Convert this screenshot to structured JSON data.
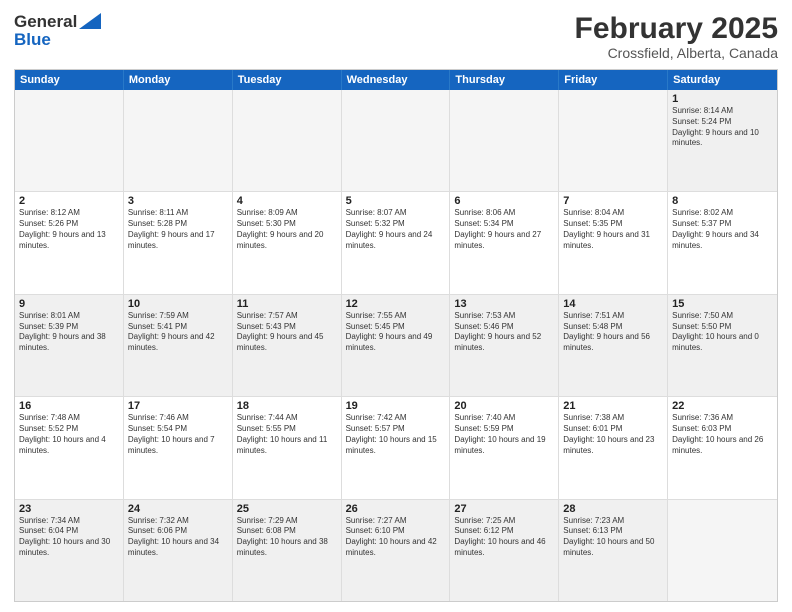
{
  "header": {
    "logo_general": "General",
    "logo_blue": "Blue",
    "month_title": "February 2025",
    "location": "Crossfield, Alberta, Canada"
  },
  "weekdays": [
    "Sunday",
    "Monday",
    "Tuesday",
    "Wednesday",
    "Thursday",
    "Friday",
    "Saturday"
  ],
  "rows": [
    [
      {
        "day": "",
        "text": "",
        "empty": true
      },
      {
        "day": "",
        "text": "",
        "empty": true
      },
      {
        "day": "",
        "text": "",
        "empty": true
      },
      {
        "day": "",
        "text": "",
        "empty": true
      },
      {
        "day": "",
        "text": "",
        "empty": true
      },
      {
        "day": "",
        "text": "",
        "empty": true
      },
      {
        "day": "1",
        "text": "Sunrise: 8:14 AM\nSunset: 5:24 PM\nDaylight: 9 hours and 10 minutes.",
        "empty": false
      }
    ],
    [
      {
        "day": "2",
        "text": "Sunrise: 8:12 AM\nSunset: 5:26 PM\nDaylight: 9 hours and 13 minutes.",
        "empty": false
      },
      {
        "day": "3",
        "text": "Sunrise: 8:11 AM\nSunset: 5:28 PM\nDaylight: 9 hours and 17 minutes.",
        "empty": false
      },
      {
        "day": "4",
        "text": "Sunrise: 8:09 AM\nSunset: 5:30 PM\nDaylight: 9 hours and 20 minutes.",
        "empty": false
      },
      {
        "day": "5",
        "text": "Sunrise: 8:07 AM\nSunset: 5:32 PM\nDaylight: 9 hours and 24 minutes.",
        "empty": false
      },
      {
        "day": "6",
        "text": "Sunrise: 8:06 AM\nSunset: 5:34 PM\nDaylight: 9 hours and 27 minutes.",
        "empty": false
      },
      {
        "day": "7",
        "text": "Sunrise: 8:04 AM\nSunset: 5:35 PM\nDaylight: 9 hours and 31 minutes.",
        "empty": false
      },
      {
        "day": "8",
        "text": "Sunrise: 8:02 AM\nSunset: 5:37 PM\nDaylight: 9 hours and 34 minutes.",
        "empty": false
      }
    ],
    [
      {
        "day": "9",
        "text": "Sunrise: 8:01 AM\nSunset: 5:39 PM\nDaylight: 9 hours and 38 minutes.",
        "empty": false
      },
      {
        "day": "10",
        "text": "Sunrise: 7:59 AM\nSunset: 5:41 PM\nDaylight: 9 hours and 42 minutes.",
        "empty": false
      },
      {
        "day": "11",
        "text": "Sunrise: 7:57 AM\nSunset: 5:43 PM\nDaylight: 9 hours and 45 minutes.",
        "empty": false
      },
      {
        "day": "12",
        "text": "Sunrise: 7:55 AM\nSunset: 5:45 PM\nDaylight: 9 hours and 49 minutes.",
        "empty": false
      },
      {
        "day": "13",
        "text": "Sunrise: 7:53 AM\nSunset: 5:46 PM\nDaylight: 9 hours and 52 minutes.",
        "empty": false
      },
      {
        "day": "14",
        "text": "Sunrise: 7:51 AM\nSunset: 5:48 PM\nDaylight: 9 hours and 56 minutes.",
        "empty": false
      },
      {
        "day": "15",
        "text": "Sunrise: 7:50 AM\nSunset: 5:50 PM\nDaylight: 10 hours and 0 minutes.",
        "empty": false
      }
    ],
    [
      {
        "day": "16",
        "text": "Sunrise: 7:48 AM\nSunset: 5:52 PM\nDaylight: 10 hours and 4 minutes.",
        "empty": false
      },
      {
        "day": "17",
        "text": "Sunrise: 7:46 AM\nSunset: 5:54 PM\nDaylight: 10 hours and 7 minutes.",
        "empty": false
      },
      {
        "day": "18",
        "text": "Sunrise: 7:44 AM\nSunset: 5:55 PM\nDaylight: 10 hours and 11 minutes.",
        "empty": false
      },
      {
        "day": "19",
        "text": "Sunrise: 7:42 AM\nSunset: 5:57 PM\nDaylight: 10 hours and 15 minutes.",
        "empty": false
      },
      {
        "day": "20",
        "text": "Sunrise: 7:40 AM\nSunset: 5:59 PM\nDaylight: 10 hours and 19 minutes.",
        "empty": false
      },
      {
        "day": "21",
        "text": "Sunrise: 7:38 AM\nSunset: 6:01 PM\nDaylight: 10 hours and 23 minutes.",
        "empty": false
      },
      {
        "day": "22",
        "text": "Sunrise: 7:36 AM\nSunset: 6:03 PM\nDaylight: 10 hours and 26 minutes.",
        "empty": false
      }
    ],
    [
      {
        "day": "23",
        "text": "Sunrise: 7:34 AM\nSunset: 6:04 PM\nDaylight: 10 hours and 30 minutes.",
        "empty": false
      },
      {
        "day": "24",
        "text": "Sunrise: 7:32 AM\nSunset: 6:06 PM\nDaylight: 10 hours and 34 minutes.",
        "empty": false
      },
      {
        "day": "25",
        "text": "Sunrise: 7:29 AM\nSunset: 6:08 PM\nDaylight: 10 hours and 38 minutes.",
        "empty": false
      },
      {
        "day": "26",
        "text": "Sunrise: 7:27 AM\nSunset: 6:10 PM\nDaylight: 10 hours and 42 minutes.",
        "empty": false
      },
      {
        "day": "27",
        "text": "Sunrise: 7:25 AM\nSunset: 6:12 PM\nDaylight: 10 hours and 46 minutes.",
        "empty": false
      },
      {
        "day": "28",
        "text": "Sunrise: 7:23 AM\nSunset: 6:13 PM\nDaylight: 10 hours and 50 minutes.",
        "empty": false
      },
      {
        "day": "",
        "text": "",
        "empty": true
      }
    ]
  ]
}
